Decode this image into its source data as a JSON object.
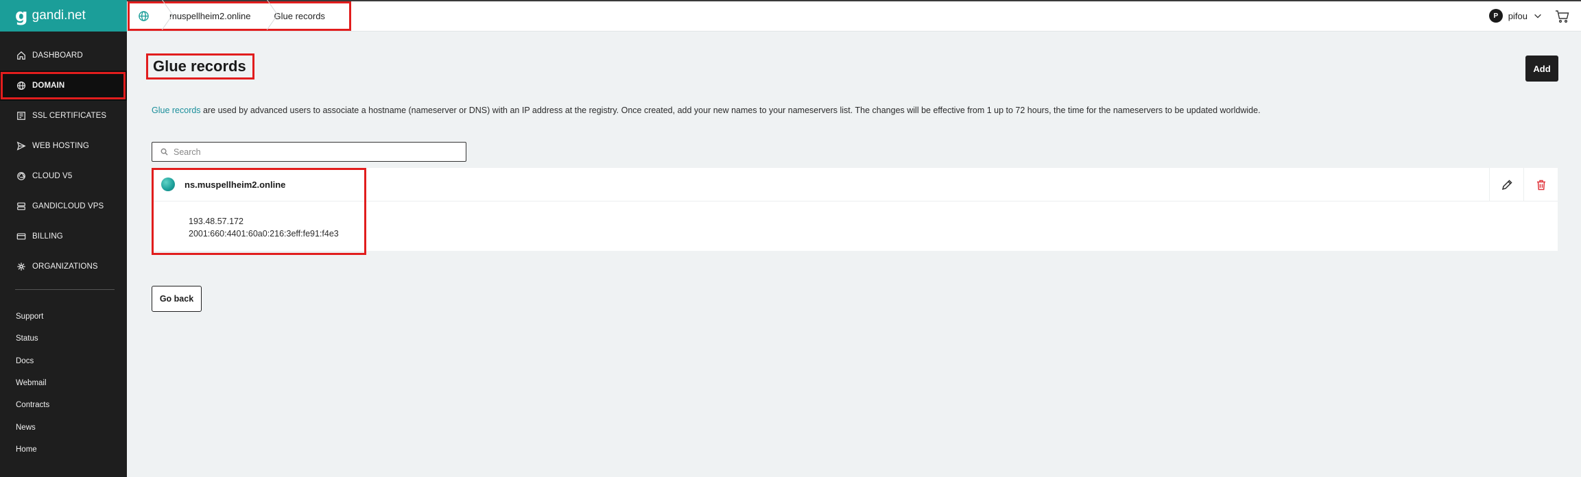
{
  "brand": {
    "name": "gandi.net",
    "mark": "g"
  },
  "sidebar": {
    "nav": [
      {
        "label": "DASHBOARD",
        "icon": "home-icon",
        "active": false
      },
      {
        "label": "DOMAIN",
        "icon": "globe-icon",
        "active": true
      },
      {
        "label": "SSL CERTIFICATES",
        "icon": "certificate-icon",
        "active": false
      },
      {
        "label": "WEB HOSTING",
        "icon": "send-icon",
        "active": false
      },
      {
        "label": "CLOUD V5",
        "icon": "cloud-icon",
        "active": false
      },
      {
        "label": "GANDICLOUD VPS",
        "icon": "server-icon",
        "active": false
      },
      {
        "label": "BILLING",
        "icon": "credit-card-icon",
        "active": false
      },
      {
        "label": "ORGANIZATIONS",
        "icon": "organizations-icon",
        "active": false
      }
    ],
    "links": [
      "Support",
      "Status",
      "Docs",
      "Webmail",
      "Contracts",
      "News",
      "Home"
    ]
  },
  "header": {
    "breadcrumb": [
      "muspellheim2.online",
      "Glue records"
    ],
    "user": {
      "initial": "P",
      "name": "pifou"
    }
  },
  "page": {
    "title": "Glue records",
    "add_label": "Add",
    "description_link": "Glue records",
    "description_rest": " are used by advanced users to associate a hostname (nameserver or DNS) with an IP address at the registry. Once created, add your new names to your nameservers list. The changes will be effective from 1 up to 72 hours, the time for the nameservers to be updated worldwide.",
    "search_placeholder": "Search",
    "go_back_label": "Go back"
  },
  "records": [
    {
      "hostname": "ns.muspellheim2.online",
      "ips": [
        "193.48.57.172",
        "2001:660:4401:60a0:216:3eff:fe91:f4e3"
      ]
    }
  ],
  "colors": {
    "brand": "#1b9e99",
    "highlight": "#e11d1d",
    "danger": "#e0363d"
  }
}
